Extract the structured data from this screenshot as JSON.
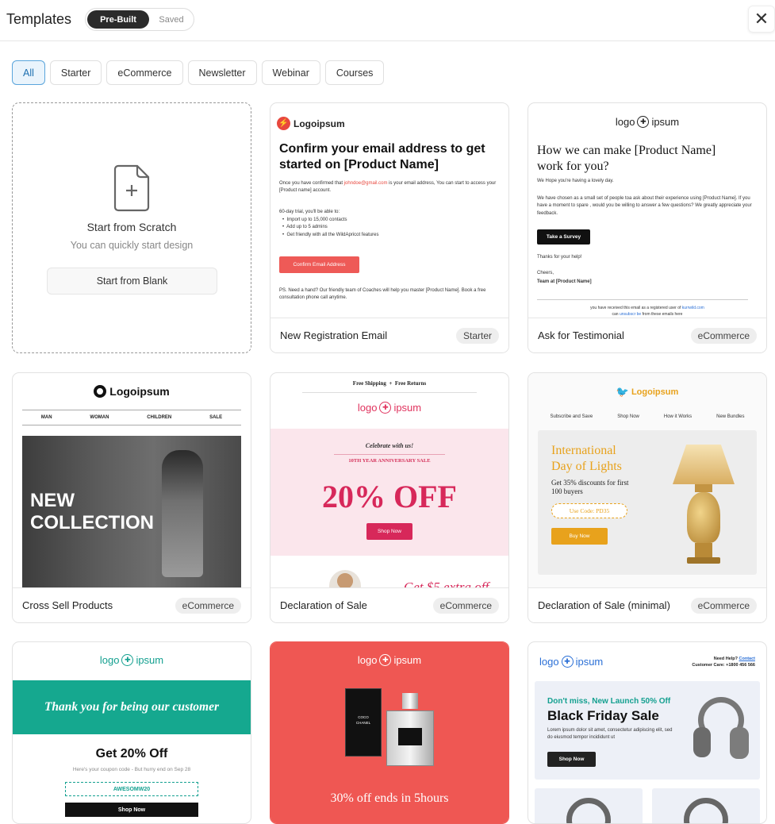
{
  "header": {
    "title": "Templates",
    "tabs": [
      "Pre-Built",
      "Saved"
    ]
  },
  "filters": [
    "All",
    "Starter",
    "eCommerce",
    "Newsletter",
    "Webinar",
    "Courses"
  ],
  "scratch": {
    "title": "Start from Scratch",
    "subtitle": "You can quickly start design",
    "button": "Start from Blank"
  },
  "cards": [
    {
      "name": "New Registration Email",
      "tag": "Starter"
    },
    {
      "name": "Ask for Testimonial",
      "tag": "eCommerce"
    },
    {
      "name": "Cross Sell Products",
      "tag": "eCommerce"
    },
    {
      "name": "Declaration of Sale",
      "tag": "eCommerce"
    },
    {
      "name": "Declaration of Sale (minimal)",
      "tag": "eCommerce"
    }
  ],
  "p1": {
    "logo": "Logoipsum",
    "heading": "Confirm your email address to get started on [Product Name]",
    "line1a": "Once you have confirmed that ",
    "email": "johndoe@gmail.com",
    "line1b": " is your email address, You can start to access your [Product name] account.",
    "trial": "60-day trial, you'll be able to:",
    "bullets": [
      "Import up to 15,000 contacts",
      "Add up to 5 admins",
      "Get friendly with all the WildApricot features"
    ],
    "button": "Confirm Email Address",
    "ps": "PS. Need a hand? Our friendly team of Coaches will help you master [Product Name]. Book a free consultation phone call anytime."
  },
  "p2": {
    "logo_a": "logo",
    "logo_b": "ipsum",
    "heading": "How we can make [Product Name] work for you?",
    "hope": "We Hope you're having a lovely day.",
    "body": "We have chosen as a small set of people toa ask about their experience using [Product Name]. If you have a moment to spare , would you be willing to answer a few questions? We greatly appreciate your feedback.",
    "button": "Take a Survey",
    "thanks": "Thanks for your help!",
    "cheers": "Cheers,",
    "team": "Team at [Product Name]",
    "foot1": "you have received this email as a registered user of ",
    "foot_link": "kurrwild.com",
    "foot2a": "can ",
    "foot_unsub": "unsubscr be",
    "foot2b": " from these emails here"
  },
  "p3": {
    "logo": "Logoipsum",
    "nav": [
      "MAN",
      "WOMAN",
      "CHILDREN",
      "SALE"
    ],
    "hero": "NEW COLLECTION"
  },
  "p4": {
    "top": "Free Shipping  +  Free Returns",
    "logo_a": "logo",
    "logo_b": "ipsum",
    "celebrate": "Celebrate with us!",
    "anniv": "10TH YEAR ANNIVERSARY SALE",
    "offer": "20% OFF",
    "button": "Shop Now",
    "teaser": "Get $5 extra off"
  },
  "p5": {
    "logo": "Logoipsum",
    "nav": [
      "Subscribe and Save",
      "Shop Now",
      "How it Works",
      "New Bundles"
    ],
    "heading": "International Day of Lights",
    "sub": "Get 35% discounts for first 100 buyers",
    "code": "Use Code: PD35",
    "button": "Buy Now"
  },
  "p6": {
    "logo_a": "logo",
    "logo_b": "ipsum",
    "thanks": "Thank you for being our customer",
    "offer": "Get 20% Off",
    "sub": "Here's your coupon code - But hurry end on  Sep 28",
    "code": "AWESOMW20",
    "button": "Shop Now"
  },
  "p7": {
    "logo_a": "logo",
    "logo_b": "ipsum",
    "brand": "COCO",
    "brand2": "CHANEL",
    "offer": "30% off ends in 5hours"
  },
  "p8": {
    "logo_a": "logo",
    "logo_b": "ipsum",
    "help": "Need Help? ",
    "contact": "Contact",
    "care": "Customer Care: +1800 456 566",
    "launch": "Don't miss, New Launch 50% Off",
    "heading": "Black Friday Sale",
    "body": "Lorem ipsum dolor sit amet, consectetur adipiscing elit, sed do eiusmod tempor incididunt ut",
    "button": "Shop Now"
  }
}
